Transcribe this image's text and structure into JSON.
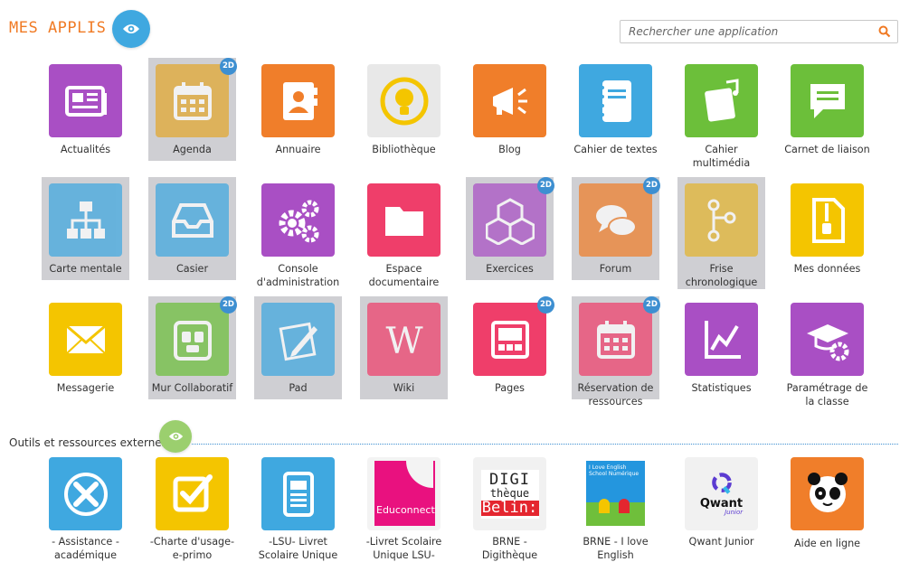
{
  "header": {
    "title": "MES APPLIS",
    "search_placeholder": "Rechercher une application"
  },
  "apps": [
    {
      "label": "Actualités",
      "icon": "newspaper-icon",
      "color": "#a94fc4",
      "disabled": false,
      "badge": ""
    },
    {
      "label": "Agenda",
      "icon": "calendar-icon",
      "color": "#e3a82e",
      "disabled": true,
      "badge": "2D"
    },
    {
      "label": "Annuaire",
      "icon": "address-book-icon",
      "color": "#f07e2a",
      "disabled": false,
      "badge": ""
    },
    {
      "label": "Bibliothèque",
      "icon": "lightbulb-icon",
      "color": "#e7e7e7",
      "disabled": false,
      "badge": ""
    },
    {
      "label": "Blog",
      "icon": "megaphone-icon",
      "color": "#f07e2a",
      "disabled": false,
      "badge": ""
    },
    {
      "label": "Cahier de textes",
      "icon": "notebook-icon",
      "color": "#3fa8e0",
      "disabled": false,
      "badge": ""
    },
    {
      "label": "Cahier multimédia",
      "icon": "multimedia-notebook-icon",
      "color": "#6cbf3a",
      "disabled": false,
      "badge": ""
    },
    {
      "label": "Carnet de liaison",
      "icon": "chat-bubble-icon",
      "color": "#6cbf3a",
      "disabled": false,
      "badge": ""
    },
    {
      "label": "Carte mentale",
      "icon": "sitemap-icon",
      "color": "#3fa8e0",
      "disabled": true,
      "badge": ""
    },
    {
      "label": "Casier",
      "icon": "inbox-tray-icon",
      "color": "#3fa8e0",
      "disabled": true,
      "badge": ""
    },
    {
      "label": "Console d'administration",
      "icon": "gears-icon",
      "color": "#a94fc4",
      "disabled": false,
      "badge": ""
    },
    {
      "label": "Espace documentaire",
      "icon": "folder-icon",
      "color": "#ef3e6a",
      "disabled": false,
      "badge": ""
    },
    {
      "label": "Exercices",
      "icon": "cubes-icon",
      "color": "#a94fc4",
      "disabled": true,
      "badge": "2D"
    },
    {
      "label": "Forum",
      "icon": "chat-bubbles-icon",
      "color": "#f07e2a",
      "disabled": true,
      "badge": "2D"
    },
    {
      "label": "Frise chronologique",
      "icon": "timeline-icon",
      "color": "#e3b42e",
      "disabled": true,
      "badge": ""
    },
    {
      "label": "Mes données",
      "icon": "zip-file-icon",
      "color": "#f4c500",
      "disabled": false,
      "badge": ""
    },
    {
      "label": "Messagerie",
      "icon": "envelope-icon",
      "color": "#f4c500",
      "disabled": false,
      "badge": ""
    },
    {
      "label": "Mur Collaboratif",
      "icon": "sticky-wall-icon",
      "color": "#6cbf3a",
      "disabled": true,
      "badge": "2D"
    },
    {
      "label": "Pad",
      "icon": "pad-icon",
      "color": "#3fa8e0",
      "disabled": true,
      "badge": ""
    },
    {
      "label": "Wiki",
      "icon": "wiki-icon",
      "color": "#ef3e6a",
      "disabled": true,
      "badge": ""
    },
    {
      "label": "Pages",
      "icon": "pages-icon",
      "color": "#ef3e6a",
      "disabled": false,
      "badge": "2D"
    },
    {
      "label": "Réservation de ressources",
      "icon": "calendar-reservation-icon",
      "color": "#ef3e6a",
      "disabled": true,
      "badge": "2D"
    },
    {
      "label": "Statistiques",
      "icon": "line-chart-icon",
      "color": "#a94fc4",
      "disabled": false,
      "badge": ""
    },
    {
      "label": "Paramétrage de la classe",
      "icon": "graduation-gear-icon",
      "color": "#a94fc4",
      "disabled": false,
      "badge": ""
    }
  ],
  "external_section": {
    "title": "Outils et ressources externes",
    "items": [
      {
        "label": "- Assistance - académique",
        "icon": "tools-icon",
        "color": "#3fa8e0"
      },
      {
        "label": "-Charte d'usage- e-primo",
        "icon": "checkbox-icon",
        "color": "#f4c500"
      },
      {
        "label": "-LSU- Livret Scolaire Unique",
        "icon": "document-icon",
        "color": "#3fa8e0"
      },
      {
        "label": "-Livret Scolaire Unique LSU-",
        "icon": "educonnect-logo",
        "color": "#e9117f",
        "logo_text": "Educonnect"
      },
      {
        "label": "BRNE - Digithèque",
        "icon": "digitheque-logo",
        "color": "#ffffff",
        "logo_lines": [
          "DIGI",
          "thèque",
          "Belin:"
        ]
      },
      {
        "label": "BRNE - I love English",
        "icon": "ilove-english-logo",
        "color": "#1f8fd6",
        "logo_text": "I Love English School Numérique"
      },
      {
        "label": "Qwant Junior",
        "icon": "qwant-junior-logo",
        "color": "#ffffff",
        "logo_text": "Qwant",
        "logo_sub": "Junior"
      },
      {
        "label": "Aide en ligne",
        "icon": "panda-icon",
        "color": "#f07e2a"
      }
    ]
  },
  "badge_color": "#3d8fd1",
  "accent_orange": "#f07a24",
  "eye_main_color": "#3fa8e0",
  "eye_ext_color": "#9bcf6e"
}
